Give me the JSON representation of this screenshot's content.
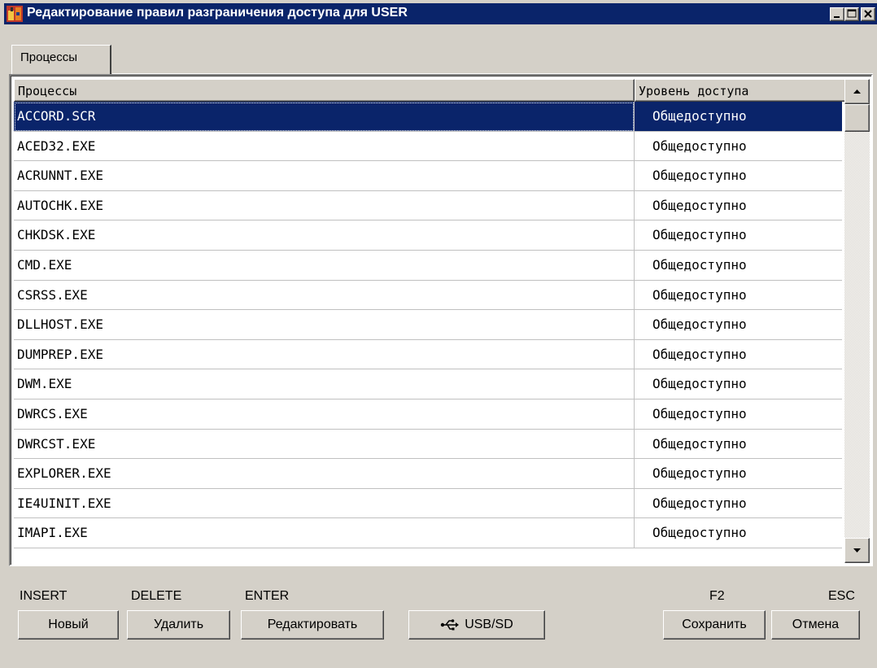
{
  "window": {
    "title": "Редактирование правил разграничения доступа для USER",
    "icon": "app-shield-icon"
  },
  "tabs": [
    {
      "label": "Процессы",
      "active": true
    }
  ],
  "list": {
    "columns": [
      "Процессы",
      "Уровень доступа"
    ],
    "rows": [
      {
        "process": "ACCORD.SCR",
        "level": "Общедоступно",
        "selected": true
      },
      {
        "process": "ACED32.EXE",
        "level": "Общедоступно"
      },
      {
        "process": "ACRUNNT.EXE",
        "level": "Общедоступно"
      },
      {
        "process": "AUTOCHK.EXE",
        "level": "Общедоступно"
      },
      {
        "process": "CHKDSK.EXE",
        "level": "Общедоступно"
      },
      {
        "process": "CMD.EXE",
        "level": "Общедоступно"
      },
      {
        "process": "CSRSS.EXE",
        "level": "Общедоступно"
      },
      {
        "process": "DLLHOST.EXE",
        "level": "Общедоступно"
      },
      {
        "process": "DUMPREP.EXE",
        "level": "Общедоступно"
      },
      {
        "process": "DWM.EXE",
        "level": "Общедоступно"
      },
      {
        "process": "DWRCS.EXE",
        "level": "Общедоступно"
      },
      {
        "process": "DWRCST.EXE",
        "level": "Общедоступно"
      },
      {
        "process": "EXPLORER.EXE",
        "level": "Общедоступно"
      },
      {
        "process": "IE4UINIT.EXE",
        "level": "Общедоступно"
      },
      {
        "process": "IMAPI.EXE",
        "level": "Общедоступно"
      }
    ]
  },
  "hotkeys": {
    "insert": "INSERT",
    "delete": "DELETE",
    "enter": "ENTER",
    "f2": "F2",
    "esc": "ESC"
  },
  "buttons": {
    "new": "Новый",
    "delete": "Удалить",
    "edit": "Редактировать",
    "usb": "USB/SD",
    "save": "Сохранить",
    "cancel": "Отмена"
  },
  "colors": {
    "titlebar": "#0a246a",
    "face": "#d4d0c8",
    "selection": "#0a246a"
  }
}
